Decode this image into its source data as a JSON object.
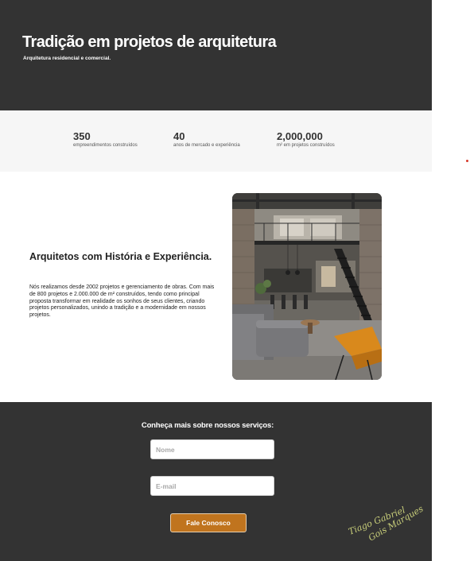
{
  "hero": {
    "title": "Tradição em projetos de arquitetura",
    "subtitle": "Arquitetura residencial e comercial."
  },
  "stats": [
    {
      "number": "350",
      "label": "empreendimentos construídos"
    },
    {
      "number": "40",
      "label": "anos de mercado e experiência"
    },
    {
      "number": "2,000,000",
      "label": "m² em projetos construídos"
    }
  ],
  "about": {
    "title": "Arquitetos com História e Experiência.",
    "text": "Nós realizamos desde 2002 projetos e gerenciamento de obras. Com mais de 800 projetos e 2.000.000 de m² construídos, tendo como principal proposta transformar em realidade os sonhos de seus clientes, criando projetos personalizados, unindo a tradição e a modernidade em nossos projetos."
  },
  "contact": {
    "title": "Conheça mais sobre nossos serviços:",
    "name_placeholder": "Nome",
    "email_placeholder": "E-mail",
    "submit_label": "Fale Conosco"
  },
  "signature": {
    "line1": "Tiago Gabriel",
    "line2": "Gois Marques"
  },
  "colors": {
    "dark": "#333333",
    "light_band": "#f6f6f6",
    "accent": "#c0741e"
  }
}
